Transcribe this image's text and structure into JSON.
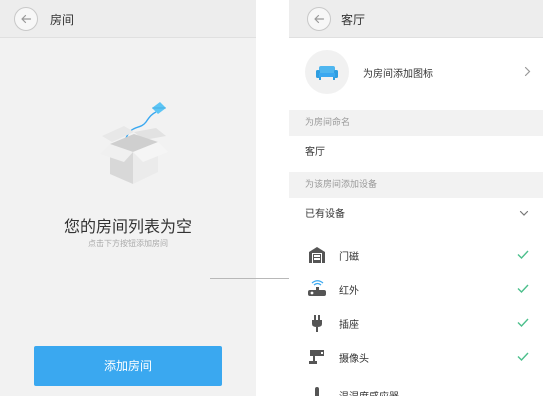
{
  "left_screen": {
    "header": {
      "title": "房间"
    },
    "empty_state": {
      "title": "您的房间列表为空",
      "subtitle": "点击下方按钮添加房间"
    },
    "add_button_label": "添加房间"
  },
  "right_screen": {
    "header": {
      "title": "客厅"
    },
    "icon_row": {
      "label": "为房间添加图标",
      "icon": "sofa-icon"
    },
    "name_section": {
      "label": "为房间命名",
      "value": "客厅"
    },
    "device_section": {
      "label": "为该房间添加设备",
      "dropdown_value": "已有设备",
      "devices": [
        {
          "label": "门磁",
          "icon": "door-sensor-icon",
          "checked": true
        },
        {
          "label": "红外",
          "icon": "infrared-icon",
          "checked": true
        },
        {
          "label": "插座",
          "icon": "plug-icon",
          "checked": true
        },
        {
          "label": "摄像头",
          "icon": "camera-icon",
          "checked": true
        },
        {
          "label": "温湿度感应器",
          "icon": "thermometer-icon",
          "checked": false
        }
      ]
    }
  },
  "colors": {
    "accent": "#3aa8f0",
    "check": "#4cbf8c",
    "background": "#f2f2f2"
  }
}
